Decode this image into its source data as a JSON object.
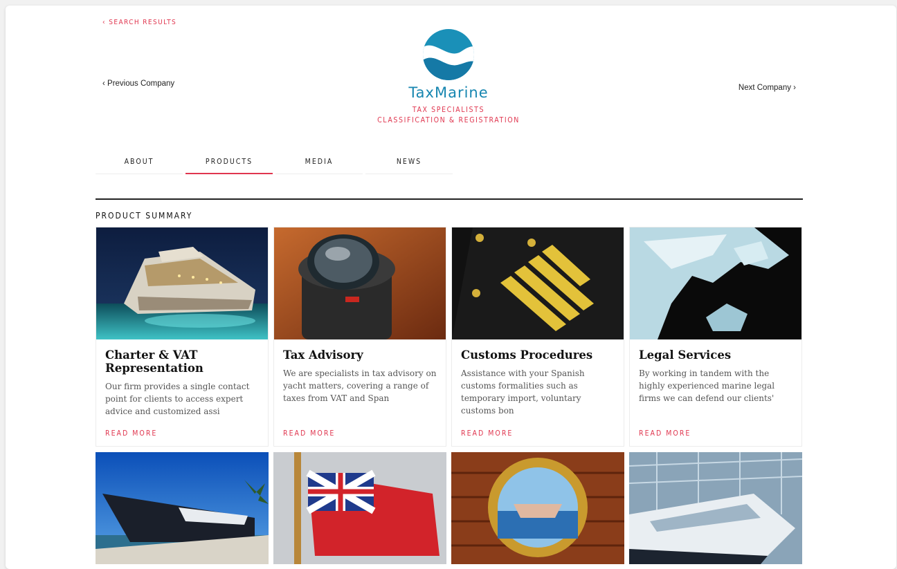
{
  "nav": {
    "search_results": "‹ SEARCH RESULTS",
    "previous_company": "‹ Previous Company",
    "next_company": "Next Company ›"
  },
  "brand": {
    "name": "TaxMarine",
    "tagline_1": "TAX SPECIALISTS",
    "tagline_2": "CLASSIFICATION & REGISTRATION",
    "logo_color": "#1786b0"
  },
  "tabs": [
    {
      "label": "ABOUT",
      "active": false
    },
    {
      "label": "PRODUCTS",
      "active": true
    },
    {
      "label": "MEDIA",
      "active": false
    },
    {
      "label": "NEWS",
      "active": false
    }
  ],
  "section_title": "PRODUCT SUMMARY",
  "products": [
    {
      "title": "Charter & VAT Representation",
      "description": "Our firm provides a single contact point for clients to access expert advice and customized assi",
      "read_more": "READ MORE",
      "image": "yacht-night"
    },
    {
      "title": "Tax Advisory",
      "description": "We are specialists in tax advisory on yacht matters, covering a range of taxes from VAT and Span",
      "read_more": "READ MORE",
      "image": "compass"
    },
    {
      "title": "Customs Procedures",
      "description": "Assistance with your Spanish customs formalities such as temporary import, voluntary customs bon",
      "read_more": "READ MORE",
      "image": "captain-epaulette"
    },
    {
      "title": "Legal Services",
      "description": "By working in tandem with the highly experienced marine legal firms we can defend our clients'",
      "read_more": "READ MORE",
      "image": "glass-sculpture"
    }
  ],
  "more_products": [
    {
      "image": "yacht-dock"
    },
    {
      "image": "red-ensign-flag"
    },
    {
      "image": "porthole-handshake"
    },
    {
      "image": "yacht-hangar"
    }
  ],
  "colors": {
    "accent": "#e0364f",
    "brand_blue": "#1786b0"
  }
}
